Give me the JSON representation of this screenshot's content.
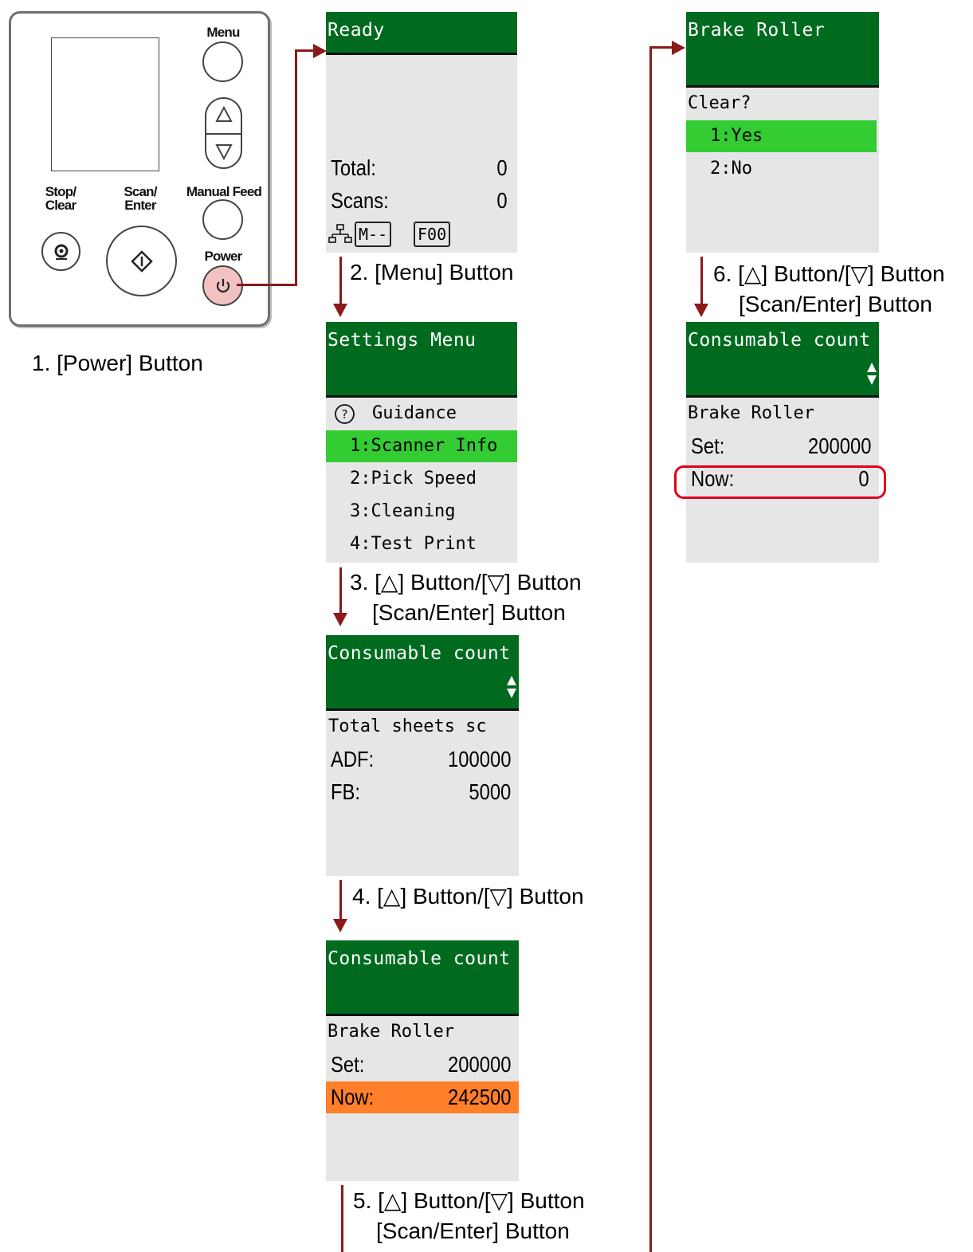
{
  "panel": {
    "menu_label": "Menu",
    "stop_label_1": "Stop/",
    "stop_label_2": "Clear",
    "scan_label_1": "Scan/",
    "scan_label_2": "Enter",
    "manual_feed_label": "Manual Feed",
    "power_label": "Power",
    "up_icon": "triangle-up",
    "down_icon": "triangle-down",
    "power_icon": "power-icon",
    "accent_color": "#f2c2c2"
  },
  "steps": {
    "step1": "1. [Power] Button",
    "step2": "2. [Menu] Button",
    "step3_line1": "3. [△] Button/[▽] Button",
    "step3_line2": "[Scan/Enter] Button",
    "step4": "4. [△] Button/[▽] Button",
    "step5_line1": "5. [△] Button/[▽] Button",
    "step5_line2": "[Scan/Enter] Button",
    "step6_line1": "6. [△] Button/[▽] Button",
    "step6_line2": "[Scan/Enter] Button"
  },
  "screens": {
    "ready": {
      "title": "Ready",
      "total_label": "Total:",
      "total_value": "0",
      "scans_label": "Scans:",
      "scans_value": "0",
      "mode_tag": "M--",
      "func_tag": "F00"
    },
    "settings": {
      "title": "Settings Menu",
      "guidance": "Guidance",
      "items": [
        "1:Scanner Info",
        "2:Pick Speed",
        "3:Cleaning",
        "4:Test Print"
      ]
    },
    "consumable1": {
      "title": "Consumable count",
      "line1": "Total sheets sc",
      "adf_label": "ADF:",
      "adf_value": "100000",
      "fb_label": "FB:",
      "fb_value": "5000"
    },
    "consumable2": {
      "title": "Consumable count",
      "line1": "Brake Roller",
      "set_label": "Set:",
      "set_value": "200000",
      "now_label": "Now:",
      "now_value": "242500"
    },
    "brake": {
      "title": "Brake Roller",
      "question": "Clear?",
      "yes": "1:Yes",
      "no": "2:No"
    },
    "consumable3": {
      "title": "Consumable count",
      "line1": "Brake Roller",
      "set_label": "Set:",
      "set_value": "200000",
      "now_label": "Now:",
      "now_value": "0"
    }
  },
  "colors": {
    "header_green": "#006b1f",
    "selection_green": "#33cc33",
    "selection_orange": "#ff7f2a",
    "arrow": "#8b1a1a",
    "highlight": "#e0001b"
  }
}
